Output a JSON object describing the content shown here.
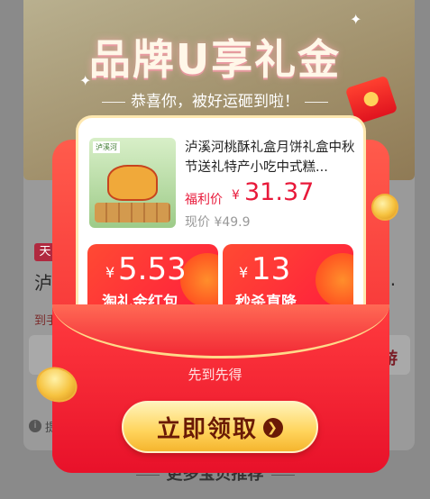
{
  "background": {
    "tag": "天",
    "text_left": "泸",
    "text_right": "...",
    "small_text": "到手",
    "box_right_text": "游",
    "info_text": "提",
    "footer_label": "更多宝贝推荐"
  },
  "popup": {
    "title": "品牌U享礼金",
    "subtitle": "恭喜你，被好运砸到啦！",
    "product": {
      "image_label": "泸溪河",
      "title": "泸溪河桃酥礼盒月饼礼盒中秋节送礼特产小吃中式糕...",
      "price_label": "福利价",
      "currency": "¥",
      "price": "31.37",
      "original_price": "现价 ¥49.9"
    },
    "coupons": [
      {
        "currency": "¥",
        "amount": "5.53",
        "label": "淘礼金红包"
      },
      {
        "currency": "¥",
        "amount": "13",
        "label": "秒杀直降"
      }
    ],
    "first_come": "先到先得",
    "cta_label": "立即领取",
    "cta_icon": "chevron-right-icon"
  },
  "colors": {
    "accent_red": "#e8193a",
    "envelope_red": "#f21d2a",
    "cta_gold": "#ffd35a",
    "cta_text": "#6a1a06"
  }
}
